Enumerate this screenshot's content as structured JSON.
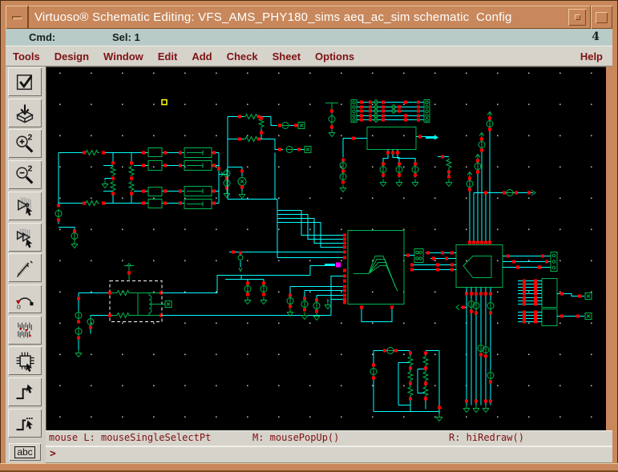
{
  "window": {
    "title": "Virtuoso® Schematic Editing: VFS_AMS_PHY180_sims aeq_ac_sim schematic  Config",
    "window_number": "4"
  },
  "status_bar": {
    "cmd_label": "Cmd:",
    "sel_label": "Sel: 1"
  },
  "menu_bar": {
    "items": [
      "Tools",
      "Design",
      "Window",
      "Edit",
      "Add",
      "Check",
      "Sheet",
      "Options"
    ],
    "help_label": "Help"
  },
  "toolbar": {
    "buttons": [
      "check-and-save",
      "save",
      "zoom-in-2x",
      "zoom-out-2x",
      "stretch",
      "copy",
      "delete",
      "undo",
      "properties",
      "instance",
      "wire",
      "wide-wire"
    ],
    "label_tool": "abc"
  },
  "mouse_bindings": {
    "left": "mouse L: mouseSingleSelectPt",
    "middle": "M: mousePopUp()",
    "right": "R: hiRedraw()"
  },
  "prompt": {
    "symbol": ">"
  },
  "selection": {
    "selected_count": 1,
    "selected_object": "instance",
    "selection_style": "dashed-white"
  },
  "colors": {
    "frame": "#c8885c",
    "status_bg": "#b9cbc7",
    "menu_bg": "#d6d3cb",
    "menu_fg": "#7e1113",
    "canvas_bg": "#000000",
    "wire": "#00ffff",
    "device": "#00b551",
    "pin": "#ff0000",
    "selected_pin": "#ff00ff",
    "cursor_box": "#ffff00",
    "title_fg": "#ffffff"
  }
}
